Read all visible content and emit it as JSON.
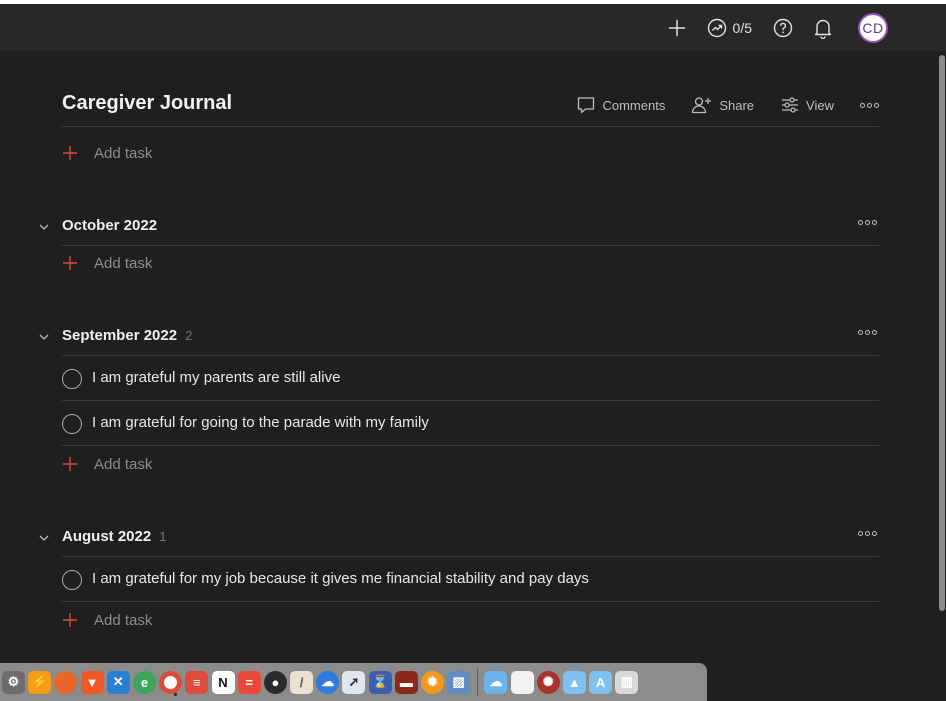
{
  "topbar": {
    "karma_label": "0/5",
    "avatar_initials": "CD",
    "avatar_ring_color": "#9b4fb8"
  },
  "project": {
    "title": "Caregiver Journal",
    "actions": {
      "comments": "Comments",
      "share": "Share",
      "view": "View"
    },
    "add_task_label": "Add task"
  },
  "sections": [
    {
      "title": "October 2022",
      "count": "",
      "tasks": [],
      "add_task_label": "Add task"
    },
    {
      "title": "September 2022",
      "count": "2",
      "tasks": [
        "I am grateful my parents are still alive",
        "I am grateful for going to the parade with my family"
      ],
      "add_task_label": "Add task"
    },
    {
      "title": "August 2022",
      "count": "1",
      "tasks": [
        "I am grateful for my job because it gives me financial stability and pay days"
      ],
      "add_task_label": "Add task"
    }
  ],
  "colors": {
    "accent_red": "#dc4c3e",
    "background": "#1f1f1f",
    "topbar": "#282828"
  },
  "dock": {
    "icons": [
      "system-preferences-icon",
      "reeder-icon",
      "firefox-icon",
      "brave-icon",
      "vscode-icon",
      "evernote-icon",
      "chrome-icon",
      "todoist-icon",
      "notion-icon",
      "toplist-icon",
      "qq-icon",
      "scrivener-icon",
      "backup-icon",
      "rocket-icon",
      "timer-icon",
      "photo-booth-icon",
      "vlc-icon",
      "preview-icon",
      "icloud-folder-icon",
      "document-icon",
      "mosaic-icon",
      "folder-icon",
      "apps-folder-icon",
      "trash-icon"
    ]
  }
}
